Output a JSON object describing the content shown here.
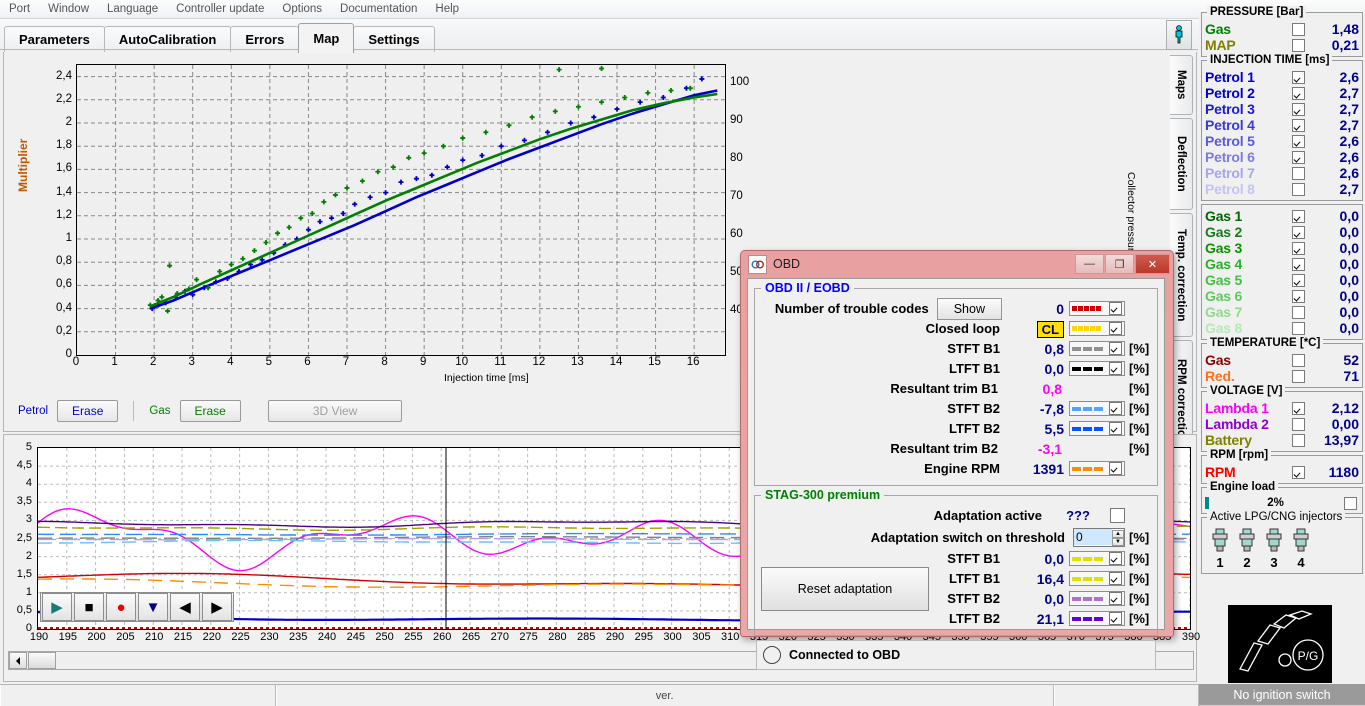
{
  "menu": {
    "items": [
      "Port",
      "Window",
      "Language",
      "Controller update",
      "Options",
      "Documentation",
      "Help"
    ]
  },
  "tabs": {
    "items": [
      {
        "label": "Parameters",
        "active": false
      },
      {
        "label": "AutoCalibration",
        "active": false
      },
      {
        "label": "Errors",
        "active": false
      },
      {
        "label": "Map",
        "active": true
      },
      {
        "label": "Settings",
        "active": false
      }
    ]
  },
  "toolbar": {
    "person_icon": "person-icon"
  },
  "map_chart": {
    "ylabel": "Multiplier",
    "xlabel": "Injection time [ms]",
    "ylabel_right": "Collector pressure",
    "yticks": [
      "2,4",
      "2,2",
      "2",
      "1,8",
      "1,6",
      "1,4",
      "1,2",
      "1",
      "0,8",
      "0,6",
      "0,4",
      "0,2",
      "0"
    ],
    "xticks": [
      "0",
      "1",
      "2",
      "3",
      "4",
      "5",
      "6",
      "7",
      "8",
      "9",
      "10",
      "11",
      "12",
      "13",
      "14",
      "15",
      "16"
    ],
    "yticks_right": [
      "100",
      "90",
      "80",
      "70",
      "60",
      "50",
      "40"
    ],
    "legend": {
      "petrol_label": "Petrol",
      "petrol_erase": "Erase",
      "gas_label": "Gas",
      "gas_erase": "Erase",
      "view3d": "3D View"
    },
    "colors": {
      "petrol": "#0000c8",
      "gas": "#008000"
    }
  },
  "chart_data": {
    "type": "scatter",
    "title": "",
    "xlabel": "Injection time [ms]",
    "ylabel": "Multiplier",
    "xlim": [
      0,
      16.8
    ],
    "ylim": [
      0,
      2.5
    ],
    "grid": true,
    "series": [
      {
        "name": "Petrol",
        "color": "#0000c8",
        "fit_x": [
          1.9,
          2.5,
          3.2,
          4.0,
          4.8,
          5.6,
          6.4,
          7.2,
          8.0,
          8.8,
          9.6,
          10.4,
          11.2,
          12.0,
          12.8,
          13.6,
          14.4,
          15.2,
          16.0,
          16.6
        ],
        "fit_y": [
          0.4,
          0.47,
          0.57,
          0.68,
          0.79,
          0.9,
          1.01,
          1.12,
          1.24,
          1.36,
          1.47,
          1.58,
          1.69,
          1.79,
          1.89,
          1.99,
          2.08,
          2.16,
          2.24,
          2.28
        ],
        "points_x": [
          1.95,
          2.1,
          2.3,
          2.55,
          2.8,
          3.0,
          3.3,
          3.6,
          3.9,
          4.2,
          4.5,
          4.8,
          5.1,
          5.4,
          5.7,
          6.0,
          6.3,
          6.6,
          6.9,
          7.2,
          7.6,
          8.0,
          8.4,
          8.8,
          9.2,
          9.6,
          10.0,
          10.5,
          11.0,
          11.6,
          12.2,
          12.8,
          13.4,
          14.0,
          14.6,
          15.2,
          15.8,
          16.2
        ],
        "points_y": [
          0.4,
          0.43,
          0.45,
          0.5,
          0.55,
          0.52,
          0.58,
          0.63,
          0.66,
          0.72,
          0.78,
          0.82,
          0.88,
          0.95,
          1.0,
          1.08,
          1.15,
          1.18,
          1.22,
          1.3,
          1.36,
          1.4,
          1.49,
          1.52,
          1.55,
          1.62,
          1.68,
          1.72,
          1.8,
          1.85,
          1.92,
          2.0,
          2.05,
          2.12,
          2.18,
          2.22,
          2.3,
          2.38
        ]
      },
      {
        "name": "Gas",
        "color": "#008000",
        "fit_x": [
          1.9,
          2.5,
          3.2,
          4.0,
          4.8,
          5.6,
          6.4,
          7.2,
          8.0,
          8.8,
          9.6,
          10.4,
          11.2,
          12.0,
          12.8,
          13.6,
          14.4,
          15.2,
          16.0,
          16.6
        ],
        "fit_y": [
          0.42,
          0.5,
          0.61,
          0.73,
          0.85,
          0.97,
          1.09,
          1.21,
          1.33,
          1.44,
          1.55,
          1.66,
          1.76,
          1.86,
          1.95,
          2.03,
          2.11,
          2.17,
          2.22,
          2.25
        ],
        "points_x": [
          1.9,
          2.1,
          2.2,
          2.35,
          2.4,
          2.6,
          2.9,
          3.1,
          3.4,
          3.7,
          4.0,
          4.3,
          4.6,
          4.9,
          5.2,
          5.5,
          5.8,
          6.1,
          6.4,
          6.7,
          7.0,
          7.4,
          7.8,
          8.2,
          8.6,
          9.0,
          9.5,
          10.0,
          10.6,
          11.2,
          11.8,
          12.4,
          13.0,
          13.6,
          14.2,
          14.8,
          15.4,
          15.9,
          12.5,
          13.6
        ],
        "points_y": [
          0.43,
          0.47,
          0.5,
          0.38,
          0.77,
          0.53,
          0.57,
          0.65,
          0.58,
          0.72,
          0.78,
          0.83,
          0.9,
          0.97,
          1.05,
          1.1,
          1.18,
          1.22,
          1.32,
          1.38,
          1.44,
          1.5,
          1.58,
          1.62,
          1.7,
          1.74,
          1.8,
          1.87,
          1.92,
          1.98,
          2.05,
          2.1,
          2.14,
          2.18,
          2.22,
          2.26,
          2.28,
          2.3,
          2.46,
          2.47
        ]
      }
    ]
  },
  "vertical_tabs": [
    "Maps",
    "Deflection",
    "Temp. correction",
    "RPM correction"
  ],
  "sidebar": {
    "groups": [
      {
        "title": "PRESSURE [Bar]",
        "rows": [
          {
            "name": "Gas",
            "color": "#008000",
            "checked": false,
            "value": "1,48"
          },
          {
            "name": "MAP",
            "color": "#808000",
            "checked": false,
            "value": "0,21"
          }
        ]
      },
      {
        "title": "INJECTION TIME [ms]",
        "rows": [
          {
            "name": "Petrol 1",
            "color": "#0000cd",
            "checked": true,
            "value": "2,6"
          },
          {
            "name": "Petrol 2",
            "color": "#0000cd",
            "checked": true,
            "value": "2,7"
          },
          {
            "name": "Petrol 3",
            "color": "#1a1ad4",
            "checked": true,
            "value": "2,7"
          },
          {
            "name": "Petrol 4",
            "color": "#3a3ad8",
            "checked": true,
            "value": "2,7"
          },
          {
            "name": "Petrol 5",
            "color": "#5a5ade",
            "checked": true,
            "value": "2,6"
          },
          {
            "name": "Petrol 6",
            "color": "#7b7be6",
            "checked": true,
            "value": "2,6"
          },
          {
            "name": "Petrol 7",
            "color": "#a5a5ee",
            "checked": false,
            "value": "2,6"
          },
          {
            "name": "Petrol 8",
            "color": "#c3c3f5",
            "checked": false,
            "value": "2,7"
          }
        ]
      },
      {
        "title": "",
        "rows": [
          {
            "name": "Gas 1",
            "color": "#006400",
            "checked": true,
            "value": "0,0"
          },
          {
            "name": "Gas 2",
            "color": "#1a7a1a",
            "checked": true,
            "value": "0,0"
          },
          {
            "name": "Gas 3",
            "color": "#0f9000",
            "checked": true,
            "value": "0,0"
          },
          {
            "name": "Gas 4",
            "color": "#2ab02a",
            "checked": true,
            "value": "0,0"
          },
          {
            "name": "Gas 5",
            "color": "#44c044",
            "checked": true,
            "value": "0,0"
          },
          {
            "name": "Gas 6",
            "color": "#5ec85e",
            "checked": true,
            "value": "0,0"
          },
          {
            "name": "Gas 7",
            "color": "#8fda8f",
            "checked": false,
            "value": "0,0"
          },
          {
            "name": "Gas 8",
            "color": "#b6e8b6",
            "checked": false,
            "value": "0,0"
          }
        ]
      },
      {
        "title": "TEMPERATURE  [*C]",
        "rows": [
          {
            "name": "Gas",
            "color": "#8b0000",
            "checked": false,
            "value": "52"
          },
          {
            "name": "Red.",
            "color": "#ff7020",
            "checked": false,
            "value": "71"
          }
        ]
      },
      {
        "title": "VOLTAGE [V]",
        "rows": [
          {
            "name": "Lambda 1",
            "color": "#ff00ff",
            "checked": true,
            "value": "2,12"
          },
          {
            "name": "Lambda 2",
            "color": "#9400d3",
            "checked": false,
            "value": "0,00"
          },
          {
            "name": "Battery",
            "color": "#808000",
            "checked": false,
            "value": "13,97"
          }
        ]
      },
      {
        "title": "RPM [rpm]",
        "rows": [
          {
            "name": "RPM",
            "color": "#ff0000",
            "checked": true,
            "value": "1180"
          }
        ]
      }
    ],
    "engine_load": {
      "title": "Engine load",
      "value": "2%",
      "checked": false,
      "fill_pct": 2
    },
    "injectors": {
      "title": "Active LPG/CNG injectors",
      "numbers": [
        "1",
        "2",
        "3",
        "4"
      ]
    },
    "status": "No ignition switch",
    "logo_text": "P/G"
  },
  "oscilloscope": {
    "yticks": [
      "5",
      "4,5",
      "4",
      "3,5",
      "3",
      "2,5",
      "2",
      "1,5",
      "1",
      "0,5",
      "0"
    ],
    "xticks": [
      "190",
      "195",
      "200",
      "205",
      "210",
      "215",
      "220",
      "225",
      "230",
      "235",
      "240",
      "245",
      "250",
      "255",
      "260",
      "265",
      "270",
      "275",
      "280",
      "285",
      "290",
      "295",
      "300",
      "305",
      "310",
      "315",
      "320",
      "325",
      "330",
      "335",
      "340",
      "345",
      "350",
      "355",
      "360",
      "365",
      "370",
      "375",
      "380",
      "385",
      "390"
    ],
    "transport": [
      {
        "name": "play-button",
        "glyph": "▶",
        "color": "#1a7a7a"
      },
      {
        "name": "stop-button",
        "glyph": "■",
        "color": "#000000"
      },
      {
        "name": "record-button",
        "glyph": "●",
        "color": "#ee0000"
      },
      {
        "name": "marker-button",
        "glyph": "▼",
        "color": "#000080"
      },
      {
        "name": "prev-button",
        "glyph": "◀",
        "color": "#000000"
      },
      {
        "name": "next-button",
        "glyph": "▶",
        "color": "#000000"
      }
    ]
  },
  "statusbar": {
    "cells": [
      "",
      "ver.",
      ""
    ]
  },
  "obd_dialog": {
    "title": "OBD",
    "window_buttons": {
      "minimize": "—",
      "maximize": "❐",
      "close": "✕"
    },
    "section1_title": "OBD II / EOBD",
    "section1_title_color": "#0000ff",
    "rows": [
      {
        "label": "Number of trouble codes",
        "value": "0",
        "button": "Show",
        "swatch": {
          "style": "dots",
          "color": "#cc0000",
          "checked": true
        },
        "unit": ""
      },
      {
        "label": "Closed loop",
        "value": "CL",
        "badge": true,
        "swatch": {
          "style": "dots",
          "color": "#ffd700",
          "checked": true
        },
        "unit": ""
      },
      {
        "label": "STFT B1",
        "value": "0,8",
        "swatch": {
          "style": "dash",
          "color": "#909090",
          "checked": true
        },
        "unit": "[%]"
      },
      {
        "label": "LTFT B1",
        "value": "0,0",
        "swatch": {
          "style": "dash",
          "color": "#000000",
          "checked": true
        },
        "unit": "[%]"
      },
      {
        "label": "Resultant trim B1",
        "value": "0,8",
        "magenta": true,
        "swatch": null,
        "unit": "[%]"
      },
      {
        "label": "STFT B2",
        "value": "-7,8",
        "swatch": {
          "style": "dash",
          "color": "#4da6ff",
          "checked": true
        },
        "unit": "[%]"
      },
      {
        "label": "LTFT B2",
        "value": "5,5",
        "swatch": {
          "style": "dash",
          "color": "#0055ff",
          "checked": true
        },
        "unit": "[%]"
      },
      {
        "label": "Resultant trim B2",
        "value": "-3,1",
        "magenta": true,
        "swatch": null,
        "unit": "[%]"
      },
      {
        "label": "Engine RPM",
        "value": "1391",
        "swatch": {
          "style": "dash",
          "color": "#ff8c00",
          "checked": true
        },
        "unit": ""
      }
    ],
    "section2_title": "STAG-300 premium",
    "section2_title_color": "#008000",
    "adaptation_active_label": "Adaptation active",
    "adaptation_active_value": "???",
    "adaptation_active_checked": false,
    "threshold_label": "Adaptation switch on threshold",
    "threshold_value": "0",
    "threshold_unit": "[%]",
    "reset_button": "Reset adaptation",
    "adapt_rows": [
      {
        "label": "STFT B1",
        "value": "0,0",
        "swatch": {
          "style": "dash",
          "color": "#e0e000",
          "checked": true
        },
        "unit": "[%]"
      },
      {
        "label": "LTFT B1",
        "value": "16,4",
        "swatch": {
          "style": "dash",
          "color": "#e0e000",
          "checked": true
        },
        "unit": "[%]"
      },
      {
        "label": "STFT B2",
        "value": "0,0",
        "swatch": {
          "style": "dash",
          "color": "#b070d0",
          "checked": true
        },
        "unit": "[%]"
      },
      {
        "label": "LTFT B2",
        "value": "21,1",
        "swatch": {
          "style": "dash",
          "color": "#6600cc",
          "checked": true
        },
        "unit": "[%]"
      }
    ],
    "connected_label": "Connected to OBD"
  }
}
